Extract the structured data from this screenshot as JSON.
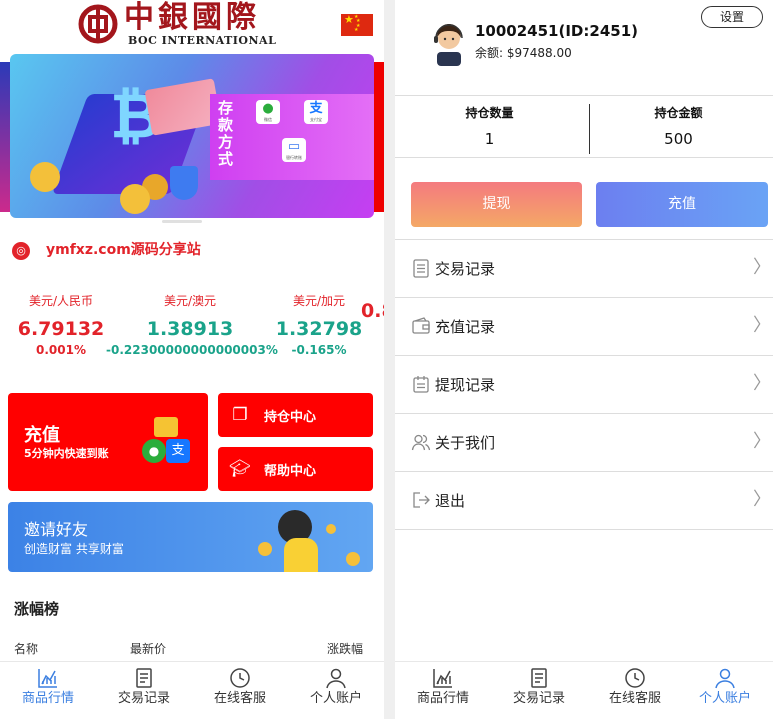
{
  "left": {
    "logo": {
      "cn": "中銀國際",
      "en": "BOC INTERNATIONAL"
    },
    "banner": {
      "panel_title": "存款方式",
      "pay_wechat": "微信",
      "pay_alipay": "支付宝",
      "pay_bank": "银行转账"
    },
    "notice": "ymfxz.com源码分享站",
    "rates": [
      {
        "pair": "美元/人民币",
        "price": "6.79132",
        "change": "0.001%",
        "trend": "up"
      },
      {
        "pair": "美元/澳元",
        "price": "1.38913",
        "change": "-0.22300000000000003%",
        "trend": "down"
      },
      {
        "pair": "美元/加元",
        "price": "1.32798",
        "change": "-0.165%",
        "trend": "down"
      },
      {
        "pair": "",
        "price": "0.8",
        "change": "",
        "trend": "up"
      }
    ],
    "quick": {
      "recharge_title": "充值",
      "recharge_sub": "5分钟内快速到账",
      "positions": "持仓中心",
      "help": "帮助中心"
    },
    "invite": {
      "title": "邀请好友",
      "sub": "创造财富 共享财富"
    },
    "rank": {
      "title": "涨幅榜",
      "col_name": "名称",
      "col_price": "最新价",
      "col_change": "涨跌幅"
    },
    "tabs": [
      {
        "label": "商品行情",
        "icon": "chart-icon",
        "active": true
      },
      {
        "label": "交易记录",
        "icon": "document-icon",
        "active": false
      },
      {
        "label": "在线客服",
        "icon": "clock-icon",
        "active": false
      },
      {
        "label": "个人账户",
        "icon": "user-icon",
        "active": false
      }
    ]
  },
  "right": {
    "user": {
      "id_line": "10002451(ID:2451)",
      "balance_label": "余额:",
      "balance_value": "$97488.00"
    },
    "settings": "设置",
    "stats": [
      {
        "label": "持仓数量",
        "value": "1"
      },
      {
        "label": "持仓金额",
        "value": "500"
      }
    ],
    "withdraw": "提现",
    "deposit": "充值",
    "menu": [
      {
        "label": "交易记录",
        "icon": "clipboard-icon"
      },
      {
        "label": "充值记录",
        "icon": "wallet-icon"
      },
      {
        "label": "提现记录",
        "icon": "calendar-icon"
      },
      {
        "label": "关于我们",
        "icon": "people-icon"
      },
      {
        "label": "退出",
        "icon": "logout-icon"
      }
    ],
    "tabs": [
      {
        "label": "商品行情",
        "icon": "chart-icon",
        "active": false
      },
      {
        "label": "交易记录",
        "icon": "document-icon",
        "active": false
      },
      {
        "label": "在线客服",
        "icon": "clock-icon",
        "active": false
      },
      {
        "label": "个人账户",
        "icon": "user-icon",
        "active": true
      }
    ]
  },
  "colors": {
    "brand_red": "#ff0000",
    "up": "#e2232a",
    "down": "#1aa38a",
    "active_tab": "#3b7fe0"
  }
}
